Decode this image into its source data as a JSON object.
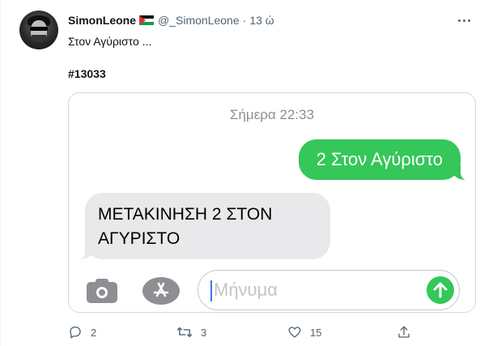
{
  "author": {
    "display_name": "SimonLeone",
    "flag": "palestine-flag",
    "handle": "@_SimonLeone",
    "separator": "·",
    "time": "13 ώ"
  },
  "tweet": {
    "text": "Στον Αγύριστο ...",
    "hashtag_prefix": "#",
    "hashtag_number": "13033"
  },
  "screenshot": {
    "date_label": "Σήμερα 22:33",
    "outgoing_message": "2 Στον Αγύριστο",
    "incoming_message_line1": "ΜΕΤΑΚΙΝΗΣΗ 2 ΣΤΟΝ",
    "incoming_message_line2": "ΑΓΥΡΙΣΤΟ",
    "input_placeholder": "Μήνυμα",
    "outgoing_color": "#35c759",
    "incoming_color": "#e9e9eb"
  },
  "actions": {
    "replies": "2",
    "retweets": "3",
    "likes": "15"
  },
  "icons": {
    "more": "more-dots-icon",
    "reply": "reply-icon",
    "retweet": "retweet-icon",
    "like": "heart-icon",
    "share": "share-icon",
    "camera": "camera-icon",
    "app_store": "app-store-icon",
    "send": "send-arrow-icon"
  }
}
